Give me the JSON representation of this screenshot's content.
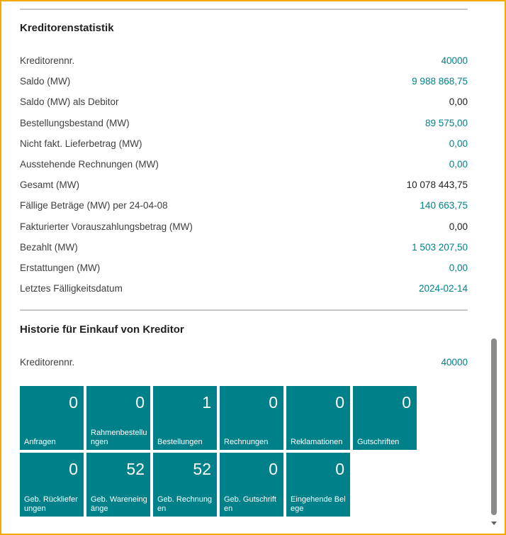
{
  "kreditorenstatistik": {
    "title": "Kreditorenstatistik",
    "rows": [
      {
        "label": "Kreditorennr.",
        "value": "40000",
        "link": true
      },
      {
        "label": "Saldo (MW)",
        "value": "9 988 868,75",
        "link": true
      },
      {
        "label": "Saldo (MW) als Debitor",
        "value": "0,00",
        "link": false
      },
      {
        "label": "Bestellungsbestand (MW)",
        "value": "89 575,00",
        "link": true
      },
      {
        "label": "Nicht fakt. Lieferbetrag (MW)",
        "value": "0,00",
        "link": true
      },
      {
        "label": "Ausstehende Rechnungen (MW)",
        "value": "0,00",
        "link": true
      },
      {
        "label": "Gesamt (MW)",
        "value": "10 078 443,75",
        "link": false
      },
      {
        "label": "Fällige Beträge (MW) per 24-04-08",
        "value": "140 663,75",
        "link": true
      },
      {
        "label": "Fakturierter Vorauszahlungsbetrag (MW)",
        "value": "0,00",
        "link": false
      },
      {
        "label": "Bezahlt (MW)",
        "value": "1 503 207,50",
        "link": true
      },
      {
        "label": "Erstattungen (MW)",
        "value": "0,00",
        "link": true
      },
      {
        "label": "Letztes Fälligkeitsdatum",
        "value": "2024-02-14",
        "link": true
      }
    ]
  },
  "historie": {
    "title": "Historie für Einkauf von Kreditor",
    "kreditorennr_label": "Kreditorennr.",
    "kreditorennr_value": "40000",
    "tiles": [
      {
        "count": "0",
        "label": "Anfragen"
      },
      {
        "count": "0",
        "label": "Rahmenbestellungen"
      },
      {
        "count": "1",
        "label": "Bestellungen"
      },
      {
        "count": "0",
        "label": "Rechnungen"
      },
      {
        "count": "0",
        "label": "Reklamationen"
      },
      {
        "count": "0",
        "label": "Gutschriften"
      },
      {
        "count": "0",
        "label": "Geb. Rücklieferungen"
      },
      {
        "count": "52",
        "label": "Geb. Wareneingänge"
      },
      {
        "count": "52",
        "label": "Geb. Rechnungen"
      },
      {
        "count": "0",
        "label": "Geb. Gutschriften"
      },
      {
        "count": "0",
        "label": "Eingehende Belege"
      }
    ]
  },
  "colors": {
    "tile": "#008089",
    "link": "#00828a",
    "frame": "#f2a900"
  },
  "scrollbar": {
    "icon": "chevron-down-icon"
  }
}
